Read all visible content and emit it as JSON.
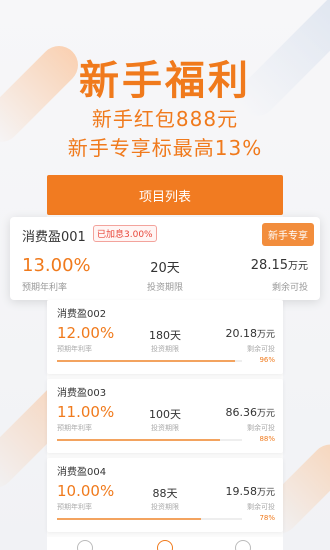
{
  "hero": {
    "title": "新手福利",
    "line1": "新手红包888元",
    "line2": "新手专享标最高13%"
  },
  "list_button": "项目列表",
  "featured": {
    "name": "消费盈001",
    "add_info": "已加息3.00%",
    "tag": "新手专享",
    "rate": "13.00%",
    "rate_label": "预期年利率",
    "term": "20天",
    "term_label": "投资期限",
    "remain_value": "28.15",
    "remain_unit": "万元",
    "remain_label": "剩余可投"
  },
  "products": [
    {
      "name": "消费盈002",
      "rate": "12.00%",
      "rate_label": "预期年利率",
      "term": "180天",
      "term_label": "投资期限",
      "remain_value": "20.18",
      "remain_unit": "万元",
      "remain_label": "剩余可投",
      "progress": 96,
      "progress_text": "96%"
    },
    {
      "name": "消费盈003",
      "rate": "11.00%",
      "rate_label": "预期年利率",
      "term": "100天",
      "term_label": "投资期限",
      "remain_value": "86.36",
      "remain_unit": "万元",
      "remain_label": "剩余可投",
      "progress": 88,
      "progress_text": "88%"
    },
    {
      "name": "消费盈004",
      "rate": "10.00%",
      "rate_label": "预期年利率",
      "term": "88天",
      "term_label": "投资期限",
      "remain_value": "19.58",
      "remain_unit": "万元",
      "remain_label": "剩余可投",
      "progress": 78,
      "progress_text": "78%"
    }
  ],
  "colors": {
    "accent": "#f07a1c",
    "button": "#f17b21",
    "tag": "#f28d3c"
  },
  "nav_icons": [
    "home-icon",
    "chart-icon",
    "user-icon"
  ]
}
